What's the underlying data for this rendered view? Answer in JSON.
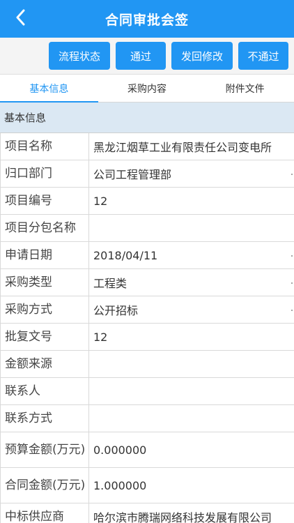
{
  "header": {
    "title": "合同审批会签"
  },
  "toolbar": {
    "buttons": [
      "流程状态",
      "通过",
      "发回修改",
      "不通过"
    ]
  },
  "tabs": [
    "基本信息",
    "采购内容",
    "附件文件"
  ],
  "section": {
    "title": "基本信息"
  },
  "fields": [
    {
      "label": "项目名称",
      "value": "黑龙江烟草工业有限责任公司变电所"
    },
    {
      "label": "归口部门",
      "value": "公司工程管理部"
    },
    {
      "label": "项目编号",
      "value": "12"
    },
    {
      "label": "项目分包名称",
      "value": ""
    },
    {
      "label": "申请日期",
      "value": "2018/04/11"
    },
    {
      "label": "采购类型",
      "value": "工程类"
    },
    {
      "label": "采购方式",
      "value": "公开招标"
    },
    {
      "label": "批复文号",
      "value": "12"
    },
    {
      "label": "金额来源",
      "value": ""
    },
    {
      "label": "联系人",
      "value": ""
    },
    {
      "label": "联系方式",
      "value": ""
    },
    {
      "label": "预算金额(万元)",
      "value": "0.000000"
    },
    {
      "label": "合同金额(万元)",
      "value": "1.000000"
    },
    {
      "label": "中标供应商",
      "value": "哈尔滨市腾瑞网络科技发展有限公司"
    }
  ],
  "colors": {
    "accent": "#2196f3",
    "section_bg": "#dbe8f3"
  },
  "icons": {
    "back": "chevron-left-icon"
  }
}
